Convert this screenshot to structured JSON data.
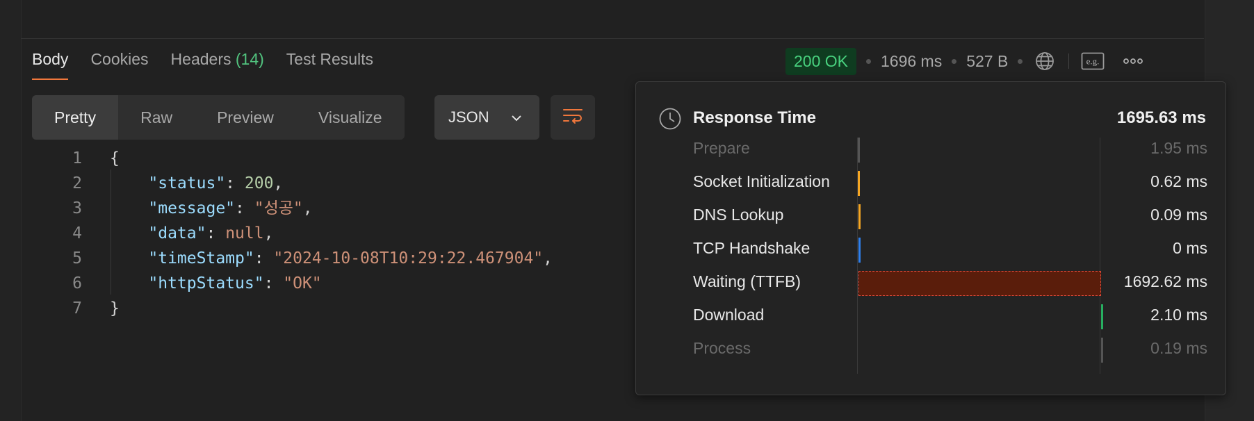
{
  "tabs": [
    {
      "label": "Body"
    },
    {
      "label": "Cookies"
    },
    {
      "label": "Headers",
      "count": "(14)"
    },
    {
      "label": "Test Results"
    }
  ],
  "status": {
    "code_text": "200 OK",
    "time": "1696 ms",
    "size": "527 B",
    "example_label": "e.g."
  },
  "view_modes": [
    "Pretty",
    "Raw",
    "Preview",
    "Visualize"
  ],
  "format": {
    "selected": "JSON"
  },
  "code_lines": [
    {
      "num": "1",
      "parts": [
        {
          "t": "{",
          "c": "p"
        }
      ]
    },
    {
      "num": "2",
      "parts": [
        {
          "t": "    ",
          "c": "p"
        },
        {
          "t": "\"status\"",
          "c": "k"
        },
        {
          "t": ": ",
          "c": "p"
        },
        {
          "t": "200",
          "c": "n"
        },
        {
          "t": ",",
          "c": "p"
        }
      ]
    },
    {
      "num": "3",
      "parts": [
        {
          "t": "    ",
          "c": "p"
        },
        {
          "t": "\"message\"",
          "c": "k"
        },
        {
          "t": ": ",
          "c": "p"
        },
        {
          "t": "\"성공\"",
          "c": "s"
        },
        {
          "t": ",",
          "c": "p"
        }
      ]
    },
    {
      "num": "4",
      "parts": [
        {
          "t": "    ",
          "c": "p"
        },
        {
          "t": "\"data\"",
          "c": "k"
        },
        {
          "t": ": ",
          "c": "p"
        },
        {
          "t": "null",
          "c": "nl"
        },
        {
          "t": ",",
          "c": "p"
        }
      ]
    },
    {
      "num": "5",
      "parts": [
        {
          "t": "    ",
          "c": "p"
        },
        {
          "t": "\"timeStamp\"",
          "c": "k"
        },
        {
          "t": ": ",
          "c": "p"
        },
        {
          "t": "\"2024-10-08T10:29:22.467904\"",
          "c": "s"
        },
        {
          "t": ",",
          "c": "p"
        }
      ]
    },
    {
      "num": "6",
      "parts": [
        {
          "t": "    ",
          "c": "p"
        },
        {
          "t": "\"httpStatus\"",
          "c": "k"
        },
        {
          "t": ": ",
          "c": "p"
        },
        {
          "t": "\"OK\"",
          "c": "s"
        }
      ]
    },
    {
      "num": "7",
      "parts": [
        {
          "t": "}",
          "c": "p"
        }
      ]
    }
  ],
  "response_time": {
    "title": "Response Time",
    "total": "1695.63 ms",
    "phases": [
      {
        "label": "Prepare",
        "value": "1.95 ms",
        "dim": true,
        "start_ms": 0,
        "duration_ms": 1.95,
        "color": "#555555"
      },
      {
        "label": "Socket Initialization",
        "value": "0.62 ms",
        "dim": false,
        "start_ms": 1.95,
        "duration_ms": 0.62,
        "color": "#f5a623"
      },
      {
        "label": "DNS Lookup",
        "value": "0.09 ms",
        "dim": false,
        "start_ms": 2.57,
        "duration_ms": 0.09,
        "color": "#f5a623"
      },
      {
        "label": "TCP Handshake",
        "value": "0 ms",
        "dim": false,
        "start_ms": 2.66,
        "duration_ms": 0,
        "color": "#2f80ed"
      },
      {
        "label": "Waiting (TTFB)",
        "value": "1692.62 ms",
        "dim": false,
        "start_ms": 2.66,
        "duration_ms": 1692.62,
        "color": "#5a1d0b"
      },
      {
        "label": "Download",
        "value": "2.10 ms",
        "dim": false,
        "start_ms": 1695.28,
        "duration_ms": 2.1,
        "color": "#27ae60"
      },
      {
        "label": "Process",
        "value": "0.19 ms",
        "dim": true,
        "start_ms": 1697.38,
        "duration_ms": 0.19,
        "color": "#555555"
      }
    ]
  }
}
